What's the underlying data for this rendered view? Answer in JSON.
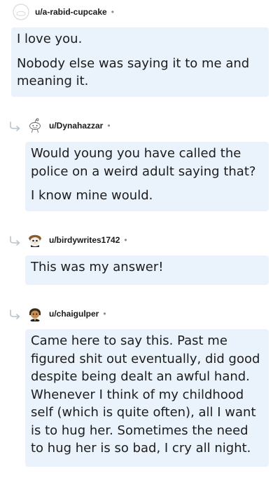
{
  "comments": [
    {
      "username": "u/a-rabid-cupcake",
      "separator": "•",
      "avatar_icon": "snoo-outline-avatar-icon",
      "paragraphs": [
        "I love you.",
        "Nobody else was saying it to me and meaning it."
      ]
    },
    {
      "username": "u/Dynahazzar",
      "separator": "•",
      "avatar_icon": "snoo-default-avatar-icon",
      "reply_icon": "reply-arrow-icon",
      "paragraphs": [
        "Would young you have called the police on a weird adult saying that?",
        "I know mine would."
      ]
    },
    {
      "username": "u/birdywrites1742",
      "separator": "•",
      "avatar_icon": "bird-avatar-icon",
      "reply_icon": "reply-arrow-icon",
      "paragraphs": [
        "This was my answer!"
      ]
    },
    {
      "username": "u/chaigulper",
      "separator": "•",
      "avatar_icon": "character-avatar-icon",
      "reply_icon": "reply-arrow-icon",
      "paragraphs": [
        "Came here to say this. Past me figured shit out eventually, did good despite being dealt an awful hand. Whenever I think of my childhood self (which is quite often), all I want is to hug her. Sometimes the need to hug her is so bad, I cry all night."
      ]
    }
  ],
  "colors": {
    "bubble_background": "#eaf3fb",
    "username_text": "#1a1a1b",
    "muted": "#878a8c"
  }
}
